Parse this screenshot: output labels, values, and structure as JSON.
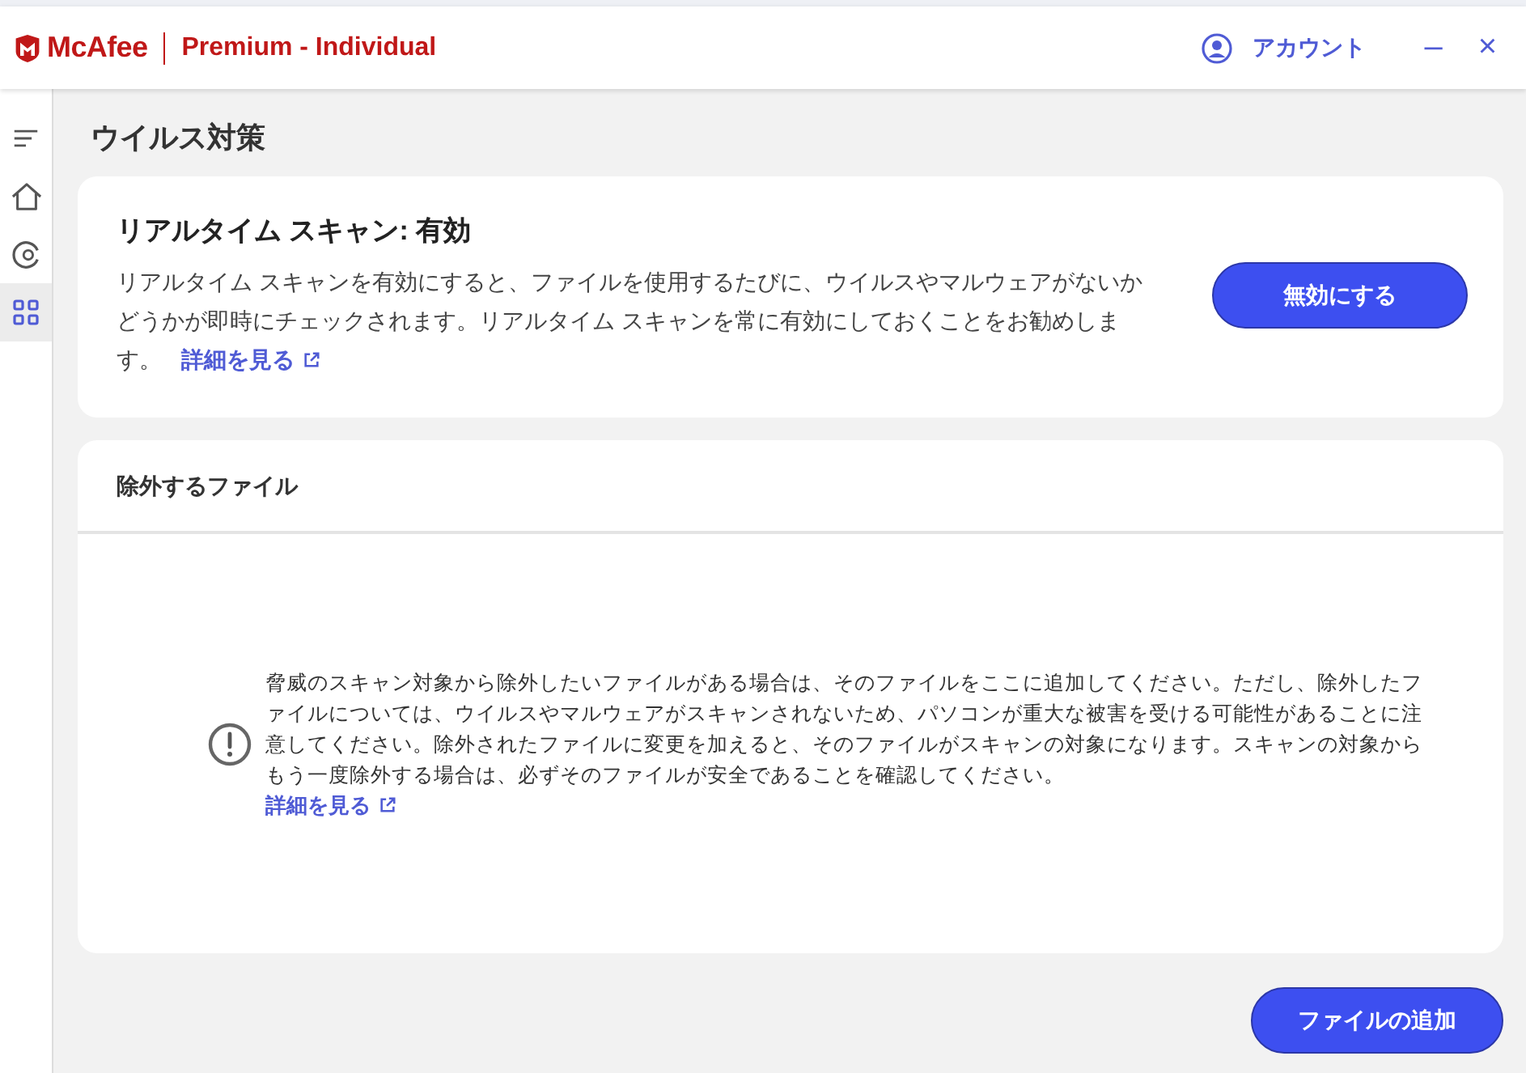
{
  "header": {
    "brand": "McAfee",
    "product": "Premium - Individual",
    "account": "アカウント",
    "minimize": "–",
    "close": "×"
  },
  "sidebar": {
    "items": [
      {
        "kind": "menu",
        "selected": false
      },
      {
        "kind": "home",
        "selected": false
      },
      {
        "kind": "privacy",
        "selected": false
      },
      {
        "kind": "apps",
        "selected": true
      }
    ]
  },
  "page_title": "ウイルス対策",
  "realtime_card": {
    "title": "リアルタイム スキャン: 有効",
    "description": "リアルタイム スキャンを有効にすると、ファイルを使用するたびに、ウイルスやマルウェアがないかどうかが即時にチェックされます。リアルタイム スキャンを常に有効にしておくことをお勧めします。",
    "link": "詳細を見る",
    "button": "無効にする"
  },
  "exclusions_card": {
    "title": "除外するファイル",
    "notice": "脅威のスキャン対象から除外したいファイルがある場合は、そのファイルをここに追加してください。ただし、除外したファイルについては、ウイルスやマルウェアがスキャンされないため、パソコンが重大な被害を受ける可能性があることに注意してください。除外されたファイルに変更を加えると、そのファイルがスキャンの対象になります。スキャンの対象からもう一度除外する場合は、必ずそのファイルが安全であることを確認してください。",
    "link": "詳細を見る"
  },
  "add_button": "ファイルの追加"
}
